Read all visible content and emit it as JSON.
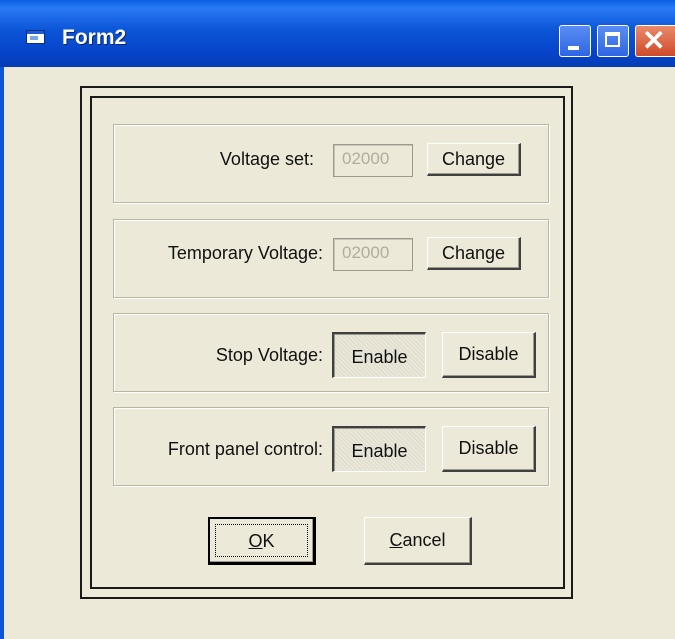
{
  "window": {
    "title": "Form2",
    "controls": {
      "minimize": "minimize",
      "maximize": "maximize",
      "close": "✕"
    }
  },
  "groups": {
    "voltage_set": {
      "label": "Voltage set:",
      "value": "02000",
      "button": "Change"
    },
    "temporary_voltage": {
      "label": "Temporary Voltage:",
      "value": "02000",
      "button": "Change"
    },
    "stop_voltage": {
      "label": "Stop Voltage:",
      "enable": "Enable",
      "disable": "Disable",
      "state": "enabled"
    },
    "front_panel_control": {
      "label": "Front panel control:",
      "enable": "Enable",
      "disable": "Disable",
      "state": "enabled"
    }
  },
  "dialog": {
    "ok_mnemonic": "O",
    "ok_rest": "K",
    "cancel_mnemonic": "C",
    "cancel_rest": "ancel"
  },
  "colors": {
    "title_bar": "#0b55d6",
    "window_bg": "#ece9d8",
    "close_button": "#d9532f",
    "disabled_text": "#b0ad9f"
  },
  "icons": {
    "app": "form-icon"
  }
}
